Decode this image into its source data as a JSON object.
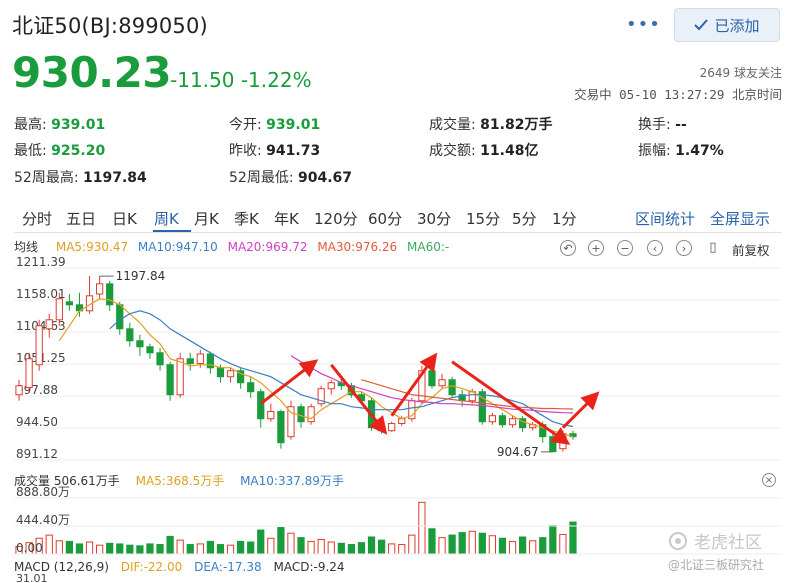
{
  "header": {
    "title": "北证50(BJ:899050)",
    "more_label": "•••",
    "added_label": "已添加",
    "price": "930.23",
    "change": "-11.50 -1.22%",
    "followers": "2649 球友关注",
    "status": "交易中 05-10 13:27:29 北京时间"
  },
  "stats": [
    {
      "label": "最高:",
      "value": "939.01",
      "tone": "green"
    },
    {
      "label": "今开:",
      "value": "939.01",
      "tone": "green"
    },
    {
      "label": "成交量:",
      "value": "81.82万手",
      "tone": "plain"
    },
    {
      "label": "换手:",
      "value": "--",
      "tone": "plain"
    },
    {
      "label": "最低:",
      "value": "925.20",
      "tone": "green"
    },
    {
      "label": "昨收:",
      "value": "941.73",
      "tone": "plain"
    },
    {
      "label": "成交额:",
      "value": "11.48亿",
      "tone": "plain"
    },
    {
      "label": "振幅:",
      "value": "1.47%",
      "tone": "plain"
    },
    {
      "label": "52周最高:",
      "value": "1197.84",
      "tone": "plain"
    },
    {
      "label": "52周最低:",
      "value": "904.67",
      "tone": "plain"
    }
  ],
  "tabs": [
    "分时",
    "五日",
    "日K",
    "周K",
    "月K",
    "季K",
    "年K",
    "120分",
    "60分",
    "30分",
    "15分",
    "5分",
    "1分"
  ],
  "active_tab": "周K",
  "tab_links": [
    "区间统计",
    "全屏显示"
  ],
  "ma_legend": {
    "title": "均线",
    "items": [
      {
        "label": "MA5:930.47",
        "color": "#e0a020"
      },
      {
        "label": "MA10:947.10",
        "color": "#3b7fc4"
      },
      {
        "label": "MA20:969.72",
        "color": "#d040c0"
      },
      {
        "label": "MA30:976.26",
        "color": "#e05a3a"
      },
      {
        "label": "MA60:-",
        "color": "#3aaa60"
      }
    ]
  },
  "controls": [
    "↶",
    "+",
    "−",
    "‹",
    "›",
    "▯"
  ],
  "fuquan_label": "前复权",
  "volume_legend": {
    "title": "成交量 506.61万手",
    "ma5": "MA5:368.5万手",
    "ma10": "MA10:337.89万手"
  },
  "macd_legend": {
    "title": "MACD (12,26,9)",
    "dif": "DIF:-22.00",
    "dea": "DEA:-17.38",
    "macd": "MACD:-9.24"
  },
  "watermark": {
    "brand": "老虎社区",
    "author": "@北证三板研究社"
  },
  "colors": {
    "up": "#e03b2c",
    "down": "#1a9c3c",
    "accent": "#2b62a8"
  },
  "chart_data": {
    "type": "candlestick",
    "y_ticks": [
      "1211.39",
      "1158.01",
      "1104.63",
      "1051.25",
      "997.88",
      "944.50",
      "891.12"
    ],
    "ylim": [
      891.12,
      1211.39
    ],
    "annotations": {
      "high": "1197.84",
      "low": "904.67"
    },
    "candles": [
      {
        "o": 1000,
        "c": 1015,
        "h": 1025,
        "l": 990
      },
      {
        "o": 1012,
        "c": 1060,
        "h": 1070,
        "l": 1005
      },
      {
        "o": 1050,
        "c": 1115,
        "h": 1125,
        "l": 1040
      },
      {
        "o": 1110,
        "c": 1125,
        "h": 1135,
        "l": 1095
      },
      {
        "o": 1125,
        "c": 1160,
        "h": 1170,
        "l": 1115
      },
      {
        "o": 1155,
        "c": 1150,
        "h": 1168,
        "l": 1140
      },
      {
        "o": 1150,
        "c": 1140,
        "h": 1170,
        "l": 1130
      },
      {
        "o": 1140,
        "c": 1165,
        "h": 1198,
        "l": 1135
      },
      {
        "o": 1168,
        "c": 1185,
        "h": 1198,
        "l": 1160
      },
      {
        "o": 1185,
        "c": 1150,
        "h": 1190,
        "l": 1140
      },
      {
        "o": 1150,
        "c": 1110,
        "h": 1155,
        "l": 1100
      },
      {
        "o": 1110,
        "c": 1090,
        "h": 1120,
        "l": 1080
      },
      {
        "o": 1090,
        "c": 1080,
        "h": 1100,
        "l": 1065
      },
      {
        "o": 1080,
        "c": 1070,
        "h": 1085,
        "l": 1060
      },
      {
        "o": 1070,
        "c": 1050,
        "h": 1078,
        "l": 1040
      },
      {
        "o": 1050,
        "c": 1000,
        "h": 1055,
        "l": 990
      },
      {
        "o": 1000,
        "c": 1060,
        "h": 1070,
        "l": 995
      },
      {
        "o": 1060,
        "c": 1052,
        "h": 1070,
        "l": 1040
      },
      {
        "o": 1052,
        "c": 1068,
        "h": 1075,
        "l": 1045
      },
      {
        "o": 1068,
        "c": 1045,
        "h": 1072,
        "l": 1035
      },
      {
        "o": 1045,
        "c": 1030,
        "h": 1050,
        "l": 1020
      },
      {
        "o": 1030,
        "c": 1040,
        "h": 1045,
        "l": 1020
      },
      {
        "o": 1040,
        "c": 1020,
        "h": 1045,
        "l": 1010
      },
      {
        "o": 1020,
        "c": 1005,
        "h": 1030,
        "l": 995
      },
      {
        "o": 1005,
        "c": 960,
        "h": 1010,
        "l": 945
      },
      {
        "o": 960,
        "c": 972,
        "h": 985,
        "l": 955
      },
      {
        "o": 972,
        "c": 920,
        "h": 975,
        "l": 910
      },
      {
        "o": 930,
        "c": 980,
        "h": 990,
        "l": 925
      },
      {
        "o": 980,
        "c": 955,
        "h": 985,
        "l": 945
      },
      {
        "o": 955,
        "c": 980,
        "h": 985,
        "l": 950
      },
      {
        "o": 985,
        "c": 1010,
        "h": 1015,
        "l": 980
      },
      {
        "o": 1010,
        "c": 1020,
        "h": 1025,
        "l": 1000
      },
      {
        "o": 1020,
        "c": 1015,
        "h": 1030,
        "l": 1008
      },
      {
        "o": 1015,
        "c": 1000,
        "h": 1020,
        "l": 995
      },
      {
        "o": 1000,
        "c": 990,
        "h": 1005,
        "l": 985
      },
      {
        "o": 990,
        "c": 945,
        "h": 995,
        "l": 940
      },
      {
        "o": 945,
        "c": 940,
        "h": 950,
        "l": 935
      },
      {
        "o": 940,
        "c": 952,
        "h": 955,
        "l": 938
      },
      {
        "o": 952,
        "c": 960,
        "h": 965,
        "l": 948
      },
      {
        "o": 960,
        "c": 990,
        "h": 995,
        "l": 955
      },
      {
        "o": 990,
        "c": 1040,
        "h": 1048,
        "l": 985
      },
      {
        "o": 1040,
        "c": 1015,
        "h": 1045,
        "l": 1010
      },
      {
        "o": 1015,
        "c": 1025,
        "h": 1035,
        "l": 1010
      },
      {
        "o": 1025,
        "c": 1000,
        "h": 1030,
        "l": 995
      },
      {
        "o": 1000,
        "c": 990,
        "h": 1008,
        "l": 980
      },
      {
        "o": 990,
        "c": 1005,
        "h": 1010,
        "l": 985
      },
      {
        "o": 1005,
        "c": 955,
        "h": 1010,
        "l": 950
      },
      {
        "o": 955,
        "c": 965,
        "h": 970,
        "l": 950
      },
      {
        "o": 965,
        "c": 950,
        "h": 970,
        "l": 945
      },
      {
        "o": 950,
        "c": 960,
        "h": 965,
        "l": 945
      },
      {
        "o": 960,
        "c": 945,
        "h": 965,
        "l": 938
      },
      {
        "o": 945,
        "c": 950,
        "h": 955,
        "l": 940
      },
      {
        "o": 950,
        "c": 930,
        "h": 955,
        "l": 920
      },
      {
        "o": 930,
        "c": 905,
        "h": 935,
        "l": 904.67
      },
      {
        "o": 910,
        "c": 935,
        "h": 940,
        "l": 905
      },
      {
        "o": 935,
        "c": 930,
        "h": 940,
        "l": 925
      }
    ],
    "series": [
      {
        "name": "MA5",
        "color": "#e0a020",
        "values": [
          null,
          null,
          null,
          null,
          1090,
          1115,
          1140,
          1150,
          1160,
          1158,
          1150,
          1135,
          1120,
          1100,
          1085,
          1060,
          1055,
          1048,
          1050,
          1050,
          1045,
          1045,
          1035,
          1030,
          1020,
          1005,
          990,
          970,
          965,
          960,
          975,
          985,
          995,
          1005,
          1005,
          995,
          980,
          970,
          960,
          965,
          985,
          995,
          1010,
          1015,
          1010,
          1005,
          995,
          985,
          975,
          965,
          955,
          950,
          945,
          940,
          935,
          930
        ]
      },
      {
        "name": "MA10",
        "color": "#3b7fc4",
        "values": [
          null,
          null,
          null,
          null,
          null,
          null,
          null,
          null,
          null,
          1110,
          1125,
          1135,
          1140,
          1135,
          1125,
          1110,
          1100,
          1090,
          1080,
          1070,
          1060,
          1052,
          1045,
          1040,
          1035,
          1030,
          1020,
          1010,
          1000,
          995,
          990,
          985,
          985,
          980,
          978,
          975,
          975,
          975,
          975,
          978,
          980,
          985,
          990,
          995,
          998,
          1000,
          1000,
          998,
          995,
          990,
          985,
          975,
          965,
          955,
          950,
          947
        ]
      },
      {
        "name": "MA20",
        "color": "#d040c0",
        "values": [
          null,
          null,
          null,
          null,
          null,
          null,
          null,
          null,
          null,
          null,
          null,
          null,
          null,
          null,
          null,
          null,
          null,
          null,
          null,
          null,
          null,
          null,
          null,
          null,
          null,
          null,
          null,
          1065,
          1055,
          1045,
          1035,
          1028,
          1020,
          1015,
          1010,
          1005,
          1000,
          995,
          992,
          990,
          988,
          987,
          985,
          985,
          984,
          983,
          982,
          980,
          978,
          976,
          975,
          974,
          972,
          971,
          970,
          969.72
        ]
      },
      {
        "name": "MA30",
        "color": "#e05a3a",
        "values": [
          null,
          null,
          null,
          null,
          null,
          null,
          null,
          null,
          null,
          null,
          null,
          null,
          null,
          null,
          null,
          null,
          null,
          null,
          null,
          null,
          null,
          null,
          null,
          null,
          null,
          null,
          null,
          null,
          null,
          null,
          null,
          null,
          null,
          null,
          1025,
          1020,
          1015,
          1010,
          1005,
          1000,
          998,
          996,
          994,
          992,
          990,
          988,
          986,
          984,
          982,
          980,
          979,
          978,
          977,
          977,
          976.5,
          976.26
        ]
      }
    ],
    "volume": [
      120,
      180,
      250,
      300,
      210,
      200,
      160,
      190,
      140,
      170,
      160,
      140,
      130,
      160,
      150,
      280,
      220,
      150,
      160,
      200,
      150,
      140,
      200,
      190,
      380,
      250,
      420,
      330,
      260,
      200,
      230,
      190,
      170,
      150,
      180,
      270,
      220,
      160,
      150,
      300,
      820,
      400,
      260,
      300,
      340,
      360,
      330,
      290,
      250,
      200,
      270,
      210,
      260,
      450,
      310,
      506.61
    ],
    "volume_ticks": [
      "888.80万",
      "444.40万",
      "0.00"
    ],
    "volume_ylim": [
      0,
      888.8
    ],
    "macd_top_tick": "31.01"
  }
}
